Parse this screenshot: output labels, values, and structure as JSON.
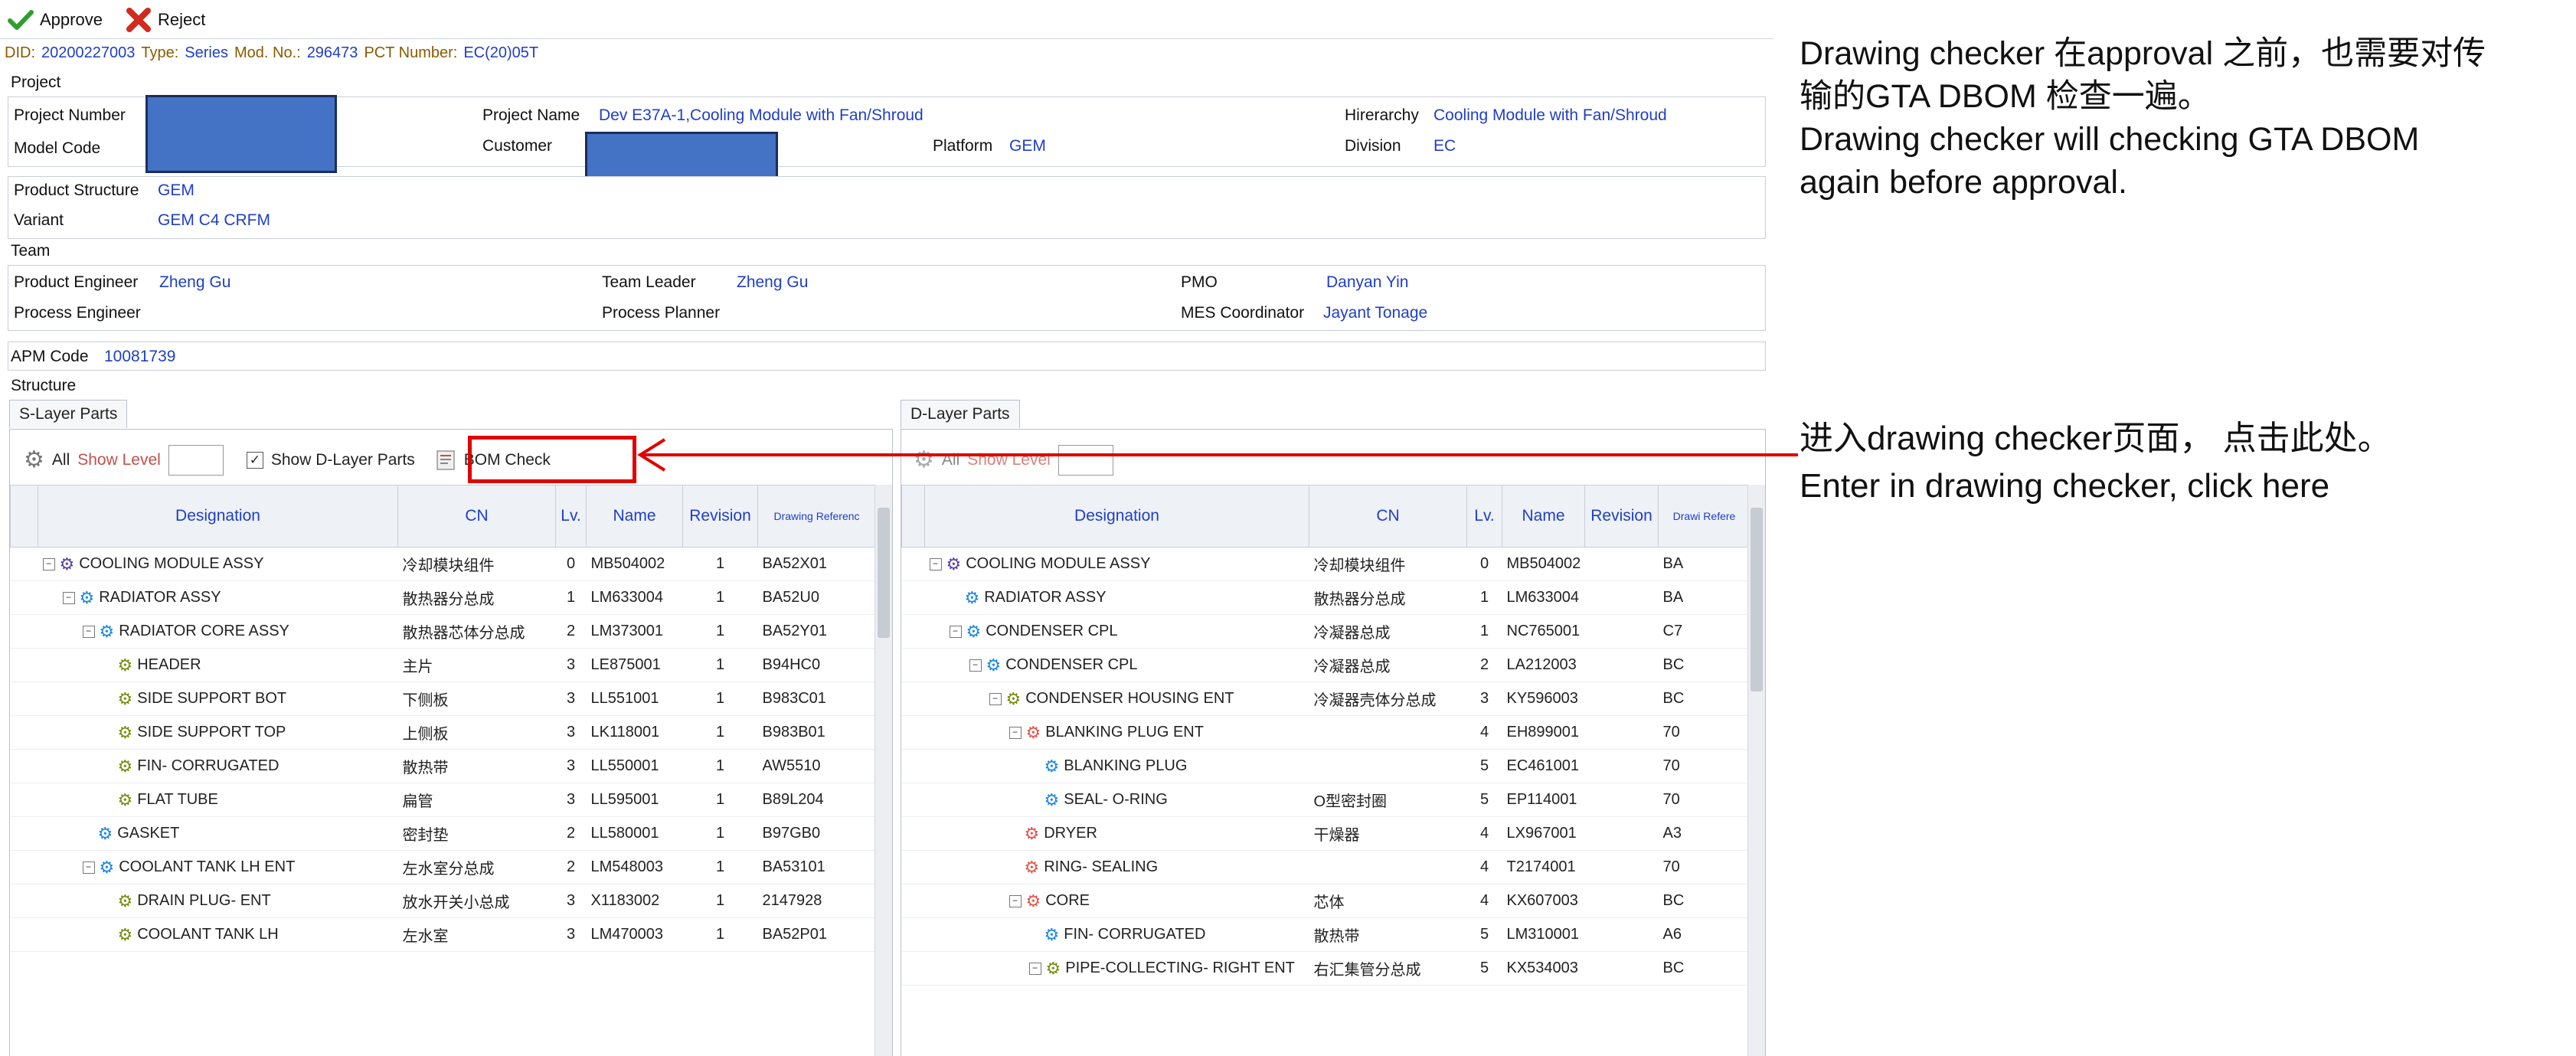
{
  "toolbar": {
    "approve_label": "Approve",
    "reject_label": "Reject"
  },
  "info_line": {
    "did_label": "DID:",
    "did_value": "20200227003",
    "type_label": "Type:",
    "type_value": "Series",
    "mod_label": "Mod. No.:",
    "mod_value": "296473",
    "pct_label": "PCT Number:",
    "pct_value": "EC(20)05T"
  },
  "project": {
    "section_label": "Project",
    "project_number_label": "Project Number",
    "project_name_label": "Project Name",
    "project_name_value": "Dev E37A-1,Cooling Module with Fan/Shroud",
    "hierarchy_label": "Hirerarchy",
    "hierarchy_value": "Cooling Module with Fan/Shroud",
    "model_code_label": "Model Code",
    "customer_label": "Customer",
    "platform_label": "Platform",
    "platform_value": "GEM",
    "division_label": "Division",
    "division_value": "EC"
  },
  "product": {
    "structure_label": "Product Structure",
    "structure_value": "GEM",
    "variant_label": "Variant",
    "variant_value": "GEM C4 CRFM"
  },
  "team": {
    "section_label": "Team",
    "product_engineer_label": "Product Engineer",
    "product_engineer_value": "Zheng Gu",
    "team_leader_label": "Team Leader",
    "team_leader_value": "Zheng Gu",
    "pmo_label": "PMO",
    "pmo_value": "Danyan Yin",
    "process_engineer_label": "Process Engineer",
    "process_planner_label": "Process Planner",
    "mes_label": "MES Coordinator",
    "mes_value": "Jayant Tonage"
  },
  "apm": {
    "label": "APM Code",
    "value": "10081739"
  },
  "structure_label": "Structure",
  "s_panel": {
    "tab": "S-Layer Parts",
    "all_label": "All",
    "show_level_label": "Show Level",
    "show_d_label": "Show D-Layer Parts",
    "bom_check_label": "BOM Check",
    "columns": [
      "Designation",
      "CN",
      "Lv.",
      "Name",
      "Revision",
      "Drawing Referenc"
    ],
    "rows": [
      {
        "designation": "COOLING MODULE ASSY",
        "cn": "冷却模块组件",
        "lv": "0",
        "name": "MB504002",
        "rev": "1",
        "ref": "BA52X01",
        "icon": "purple",
        "depth": 0,
        "toggle": true
      },
      {
        "designation": "RADIATOR ASSY",
        "cn": "散热器分总成",
        "lv": "1",
        "name": "LM633004",
        "rev": "1",
        "ref": "BA52U0",
        "icon": "blue",
        "depth": 1,
        "toggle": true
      },
      {
        "designation": "RADIATOR CORE ASSY",
        "cn": "散热器芯体分总成",
        "lv": "2",
        "name": "LM373001",
        "rev": "1",
        "ref": "BA52Y01",
        "icon": "blue",
        "depth": 2,
        "toggle": true
      },
      {
        "designation": "HEADER",
        "cn": "主片",
        "lv": "3",
        "name": "LE875001",
        "rev": "1",
        "ref": "B94HC0",
        "icon": "olive",
        "depth": 3,
        "toggle": false
      },
      {
        "designation": "SIDE SUPPORT BOT",
        "cn": "下侧板",
        "lv": "3",
        "name": "LL551001",
        "rev": "1",
        "ref": "B983C01",
        "icon": "olive",
        "depth": 3,
        "toggle": false
      },
      {
        "designation": "SIDE SUPPORT TOP",
        "cn": "上侧板",
        "lv": "3",
        "name": "LK118001",
        "rev": "1",
        "ref": "B983B01",
        "icon": "olive",
        "depth": 3,
        "toggle": false
      },
      {
        "designation": "FIN- CORRUGATED",
        "cn": "散热带",
        "lv": "3",
        "name": "LL550001",
        "rev": "1",
        "ref": "AW5510",
        "icon": "olive",
        "depth": 3,
        "toggle": false
      },
      {
        "designation": "FLAT TUBE",
        "cn": "扁管",
        "lv": "3",
        "name": "LL595001",
        "rev": "1",
        "ref": "B89L204",
        "icon": "olive",
        "depth": 3,
        "toggle": false
      },
      {
        "designation": "GASKET",
        "cn": "密封垫",
        "lv": "2",
        "name": "LL580001",
        "rev": "1",
        "ref": "B97GB0",
        "icon": "blue",
        "depth": 2,
        "toggle": false
      },
      {
        "designation": "COOLANT TANK LH ENT",
        "cn": "左水室分总成",
        "lv": "2",
        "name": "LM548003",
        "rev": "1",
        "ref": "BA53101",
        "icon": "blue",
        "depth": 2,
        "toggle": true
      },
      {
        "designation": "DRAIN PLUG- ENT",
        "cn": "放水开关小总成",
        "lv": "3",
        "name": "X1183002",
        "rev": "1",
        "ref": "2147928",
        "icon": "olive",
        "depth": 3,
        "toggle": false
      },
      {
        "designation": "COOLANT TANK LH",
        "cn": "左水室",
        "lv": "3",
        "name": "LM470003",
        "rev": "1",
        "ref": "BA52P01",
        "icon": "olive",
        "depth": 3,
        "toggle": false
      }
    ]
  },
  "d_panel": {
    "tab": "D-Layer Parts",
    "all_label": "All",
    "show_level_label": "Show Level",
    "columns": [
      "Designation",
      "CN",
      "Lv.",
      "Name",
      "Revision",
      "Drawi Refere"
    ],
    "rows": [
      {
        "designation": "COOLING MODULE ASSY",
        "cn": "冷却模块组件",
        "lv": "0",
        "name": "MB504002",
        "ref": "BA",
        "icon": "purple",
        "depth": 0,
        "toggle": true
      },
      {
        "designation": "RADIATOR ASSY",
        "cn": "散热器分总成",
        "lv": "1",
        "name": "LM633004",
        "ref": "BA",
        "icon": "blue",
        "depth": 1,
        "toggle": false
      },
      {
        "designation": "CONDENSER CPL",
        "cn": "冷凝器总成",
        "lv": "1",
        "name": "NC765001",
        "ref": "C7",
        "icon": "blue",
        "depth": 1,
        "toggle": true
      },
      {
        "designation": "CONDENSER CPL",
        "cn": "冷凝器总成",
        "lv": "2",
        "name": "LA212003",
        "ref": "BC",
        "icon": "blue",
        "depth": 2,
        "toggle": true
      },
      {
        "designation": "CONDENSER HOUSING ENT",
        "cn": "冷凝器壳体分总成",
        "lv": "3",
        "name": "KY596003",
        "ref": "BC",
        "icon": "olive",
        "depth": 3,
        "toggle": true
      },
      {
        "designation": "BLANKING PLUG ENT",
        "cn": "",
        "lv": "4",
        "name": "EH899001",
        "ref": "70",
        "icon": "red",
        "depth": 4,
        "toggle": true
      },
      {
        "designation": "BLANKING PLUG",
        "cn": "",
        "lv": "5",
        "name": "EC461001",
        "ref": "70",
        "icon": "blue",
        "depth": 5,
        "toggle": false
      },
      {
        "designation": "SEAL- O-RING",
        "cn": "O型密封圈",
        "lv": "5",
        "name": "EP114001",
        "ref": "70",
        "icon": "blue",
        "depth": 5,
        "toggle": false
      },
      {
        "designation": "DRYER",
        "cn": "干燥器",
        "lv": "4",
        "name": "LX967001",
        "ref": "A3",
        "icon": "red",
        "depth": 4,
        "toggle": false
      },
      {
        "designation": "RING- SEALING",
        "cn": "",
        "lv": "4",
        "name": "T2174001",
        "ref": "70",
        "icon": "red",
        "depth": 4,
        "toggle": false
      },
      {
        "designation": "CORE",
        "cn": "芯体",
        "lv": "4",
        "name": "KX607003",
        "ref": "BC",
        "icon": "red",
        "depth": 4,
        "toggle": true
      },
      {
        "designation": "FIN- CORRUGATED",
        "cn": "散热带",
        "lv": "5",
        "name": "LM310001",
        "ref": "A6",
        "icon": "blue",
        "depth": 5,
        "toggle": false
      },
      {
        "designation": "PIPE-COLLECTING- RIGHT ENT",
        "cn": "右汇集管分总成",
        "lv": "5",
        "name": "KX534003",
        "ref": "BC",
        "icon": "olive",
        "depth": 5,
        "toggle": true
      }
    ]
  },
  "annotations": {
    "note1_line1": "Drawing checker 在approval 之前，也需要对传",
    "note1_line2": "输的GTA DBOM 检查一遍。",
    "note1_line3": "Drawing checker will checking GTA DBOM",
    "note1_line4": "again before approval.",
    "note2_line1": "进入drawing checker页面， 点击此处。",
    "note2_line2": "Enter in drawing checker, click here"
  },
  "colors": {
    "value_blue": "#1f3ec9",
    "redact_blue": "#4472c4",
    "highlight_red": "#e00000",
    "show_level_red": "#c0504d"
  }
}
